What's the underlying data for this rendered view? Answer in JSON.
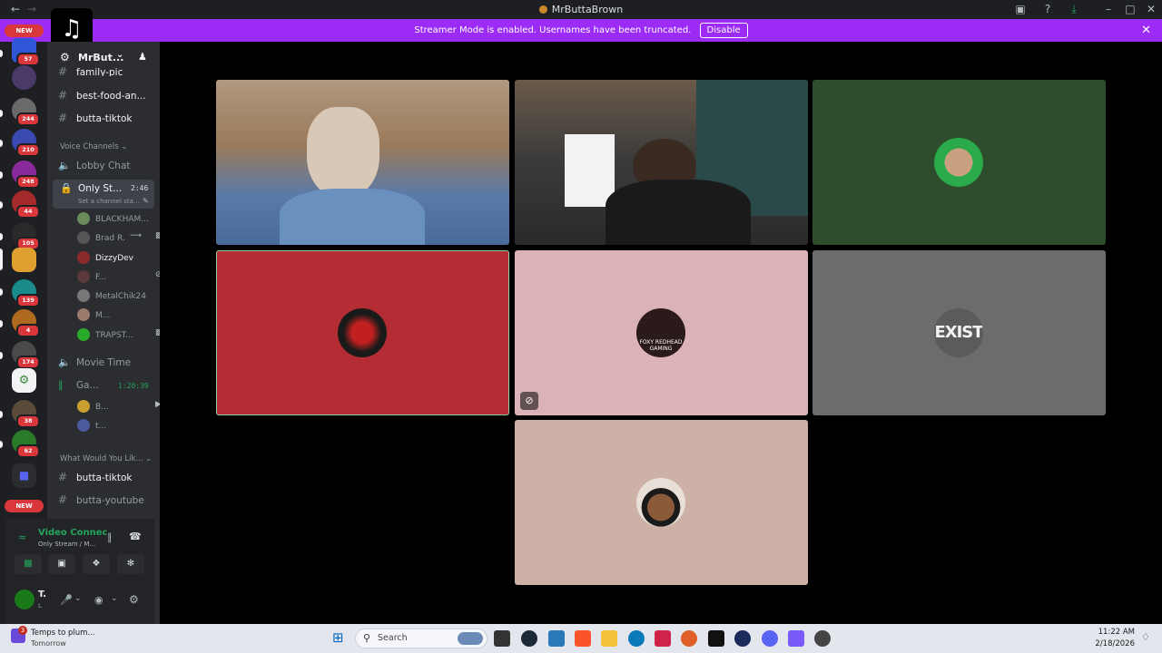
{
  "window": {
    "title": "MrButtaBrown"
  },
  "banner": {
    "text": "Streamer Mode is enabled. Usernames have been truncated.",
    "disable_label": "Disable"
  },
  "servers": {
    "new_label_top": "NEW",
    "new_label_bottom": "NEW",
    "badges": [
      "57",
      "244",
      "210",
      "248",
      "44",
      "105",
      "139",
      "4",
      "174",
      "38",
      "62"
    ]
  },
  "sidebar": {
    "server_name": "MrBut...",
    "text_channels_top": [
      "family-pic",
      "best-food-an...",
      "butta-tiktok"
    ],
    "voice_category": "Voice Channels",
    "voice_channels": {
      "lobby": "Lobby Chat",
      "only_stream": "Only St...",
      "only_stream_timer": "2:46",
      "only_stream_status": "Set a channel sta...",
      "movie_time": "Movie Time",
      "gaming": "Ga...",
      "gaming_timer": "1:20:39"
    },
    "only_stream_users": [
      "BLACKHAM...",
      "Brad R.",
      "DizzyDev",
      "F...",
      "MetalChik24",
      "M...",
      "TRAPST..."
    ],
    "gaming_users": [
      "B...",
      "t..."
    ],
    "category_2": "What Would You Lik...",
    "text_channels_bottom": [
      "butta-tiktok",
      "butta-youtube"
    ]
  },
  "voice_panel": {
    "status": "Video Connec",
    "channel": "Only Stream / M...",
    "user_initial": "T.",
    "user_sub": "L"
  },
  "stage": {
    "avatar_tile_text": "EXIST",
    "foxy_text": "FOXY REDHEAD GAMING"
  },
  "taskbar": {
    "weather_text": "Temps to plum...",
    "weather_sub": "Tomorrow",
    "search_placeholder": "Search",
    "time": "11:22 AM",
    "date": "2/18/2026",
    "weather_badge": "3"
  },
  "colors": {
    "streamer_banner": "#9b2bf5",
    "tile_green": "#2d4d2d",
    "tile_red": "#b42c34",
    "tile_pink": "#dcb2b9",
    "tile_gray": "#6b6c6e",
    "tile_beige": "#cdb1a6",
    "voice_connected": "#23a55a"
  }
}
